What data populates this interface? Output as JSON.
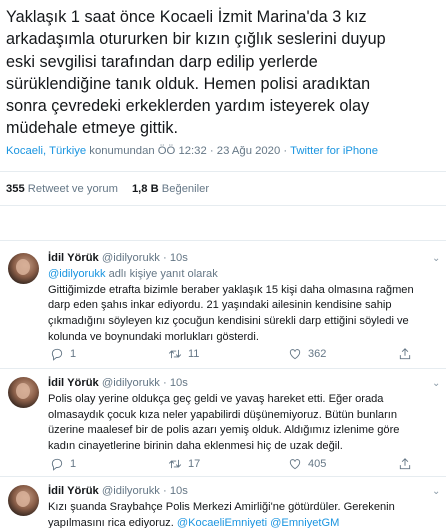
{
  "tweet": {
    "text_lines": [
      "Yaklaşık 1 saat önce Kocaeli İzmit Marina'da 3 kız",
      "arkadaşımla otururken bir kızın çığlık seslerini duyup",
      "eski sevgilisi tarafından darp edilip yerlerde",
      "sürüklendiğine tanık olduk. Hemen polisi aradıktan",
      "sonra çevredeki erkeklerden yardım isteyerek olay",
      "müdehale etmeye gittik."
    ],
    "location": "Kocaeli, Türkiye",
    "location_suffix": " konumundan ÖÖ 12:32 · 23 Ağu 2020 · ",
    "source": "Twitter for iPhone",
    "retweets_count": "355",
    "retweets_label": "Retweet ve yorum",
    "likes_count": "1,8 B",
    "likes_label": "Beğeniler"
  },
  "replies": [
    {
      "name": "İdil Yörük",
      "meta": "@idilyorukk · 10s",
      "replying_to": "@idilyorukk",
      "replying_suffix": " adlı kişiye yanıt olarak",
      "lines": [
        "Gittiğimizde etrafta bizimle beraber yaklaşık 15 kişi daha olmasına rağmen",
        "darp eden şahıs inkar ediyordu. 21 yaşındaki ailesinin kendisine sahip",
        "çıkmadığını söyleyen kız çocuğun kendisini sürekli darp ettiğini söyledi ve",
        "kolunda ve boynundaki morlukları gösterdi."
      ],
      "reply_count": "1",
      "retweet_count": "11",
      "like_count": "362"
    },
    {
      "name": "İdil Yörük",
      "meta": "@idilyorukk · 10s",
      "lines": [
        "Polis olay yerine oldukça geç geldi ve yavaş hareket etti. Eğer orada",
        "olmasaydık çocuk kıza neler yapabilirdi düşünemiyoruz. Bütün bunların",
        "üzerine maalesef bir de polis azarı yemiş olduk. Aldığımız izlenime göre",
        "kadın cinayetlerine birinin daha eklenmesi hiç de uzak değil."
      ],
      "reply_count": "1",
      "retweet_count": "17",
      "like_count": "405"
    },
    {
      "name": "İdil Yörük",
      "meta": "@idilyorukk · 10s",
      "line1": "Kızı şuanda Sraybahçe Polis Merkezi Amirliği'ne götürdüler. Gerekenin",
      "line2_prefix": "yapılmasını rica ediyoruz. ",
      "mention1": "@KocaeliEmniyeti",
      "line2_sep": " ",
      "mention2": "@EmniyetGM"
    }
  ],
  "colors": {
    "link": "#1b95e0",
    "secondary": "#657786",
    "divider": "#e6ecf0"
  }
}
